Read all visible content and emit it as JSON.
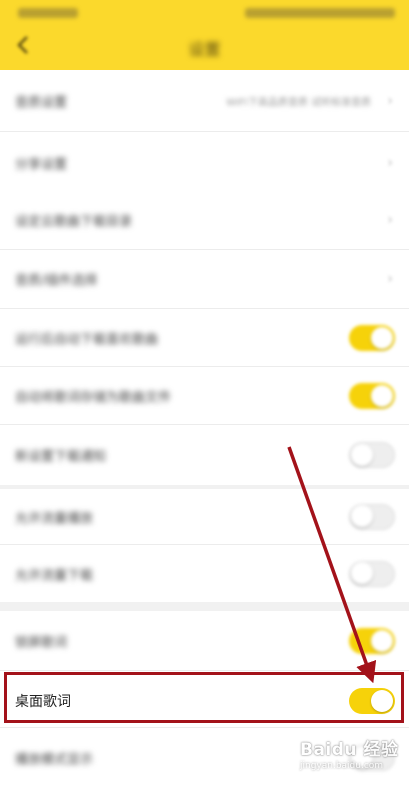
{
  "header": {
    "title": "设置"
  },
  "settings": {
    "row1": {
      "label": "音质设置",
      "value": "WIFI下高品质音质 试听标准音质"
    },
    "row2": {
      "label": "分享设置"
    },
    "row3": {
      "label": "设定云歌曲下载目录"
    },
    "row4": {
      "label": "音质/插件选择"
    },
    "row5": {
      "label": "运行后自动下载喜欢歌曲",
      "toggle": "on"
    },
    "row6": {
      "label": "自动将歌词存储为歌曲文件",
      "toggle": "on"
    },
    "row7": {
      "label": "新设置下载通知",
      "toggle": "off"
    },
    "row8": {
      "label": "允许流量播放",
      "toggle": "off"
    },
    "row9": {
      "label": "允许流量下载",
      "toggle": "off"
    },
    "row10": {
      "label": "锁屏歌词",
      "toggle": "on"
    },
    "row11": {
      "label": "桌面歌词",
      "toggle": "on"
    },
    "row12": {
      "label": "播放模式显示",
      "toggle": "off"
    }
  },
  "colors": {
    "accent": "#fbd92c",
    "toggle_on": "#f6d20a",
    "annotation": "#a3121a"
  },
  "watermark": {
    "brand": "Baidu 经验",
    "sub": "jingyan.baidu.com"
  }
}
